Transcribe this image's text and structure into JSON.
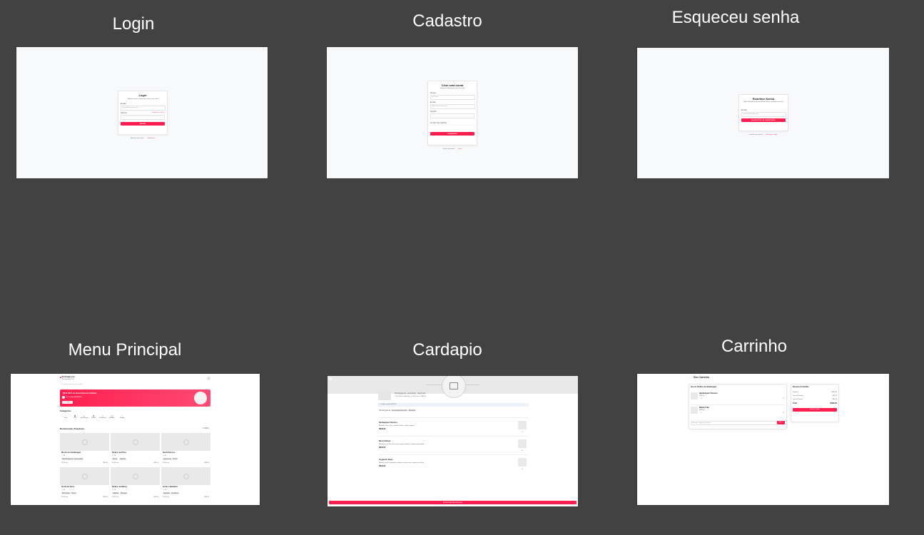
{
  "frames": {
    "login": {
      "title": "Login",
      "heading": "Login",
      "subtitle": "Digite seu email e senha para acessar sua conta",
      "email_label": "Email",
      "email_placeholder": "seuemail@exemplo.com",
      "password_label": "Senha",
      "forgot_link": "Esqueceu a senha?",
      "submit": "Entrar",
      "footer_text": "Não tem uma conta?",
      "footer_link": "Cadastre-se"
    },
    "cadastro": {
      "title": "Cadastro",
      "heading": "Criar uma conta",
      "subtitle": "Digite seus dados para criar sua conta",
      "name_label": "Nome",
      "name_placeholder": "Seu nome",
      "email_label": "Email",
      "email_placeholder": "seuemail@exemplo.com",
      "password_label": "Senha",
      "confirm_label": "Confirmar Senha",
      "submit": "Cadastrar",
      "footer_text": "Já tem uma conta?",
      "footer_link": "Entrar"
    },
    "esqueceu": {
      "title": "Esqueceu senha",
      "heading": "Redefinir Senha",
      "subtitle": "Digite seu email e enviaremos um link para redefinir sua senha",
      "email_label": "Email",
      "email_placeholder": "seuemail@exemplo.com",
      "submit": "Enviar link de redefinição",
      "footer_text": "Lembrou sua senha?",
      "footer_link": "Voltar para o login"
    },
    "menu": {
      "title": "Menu Principal",
      "location_title": "Entregar em",
      "location_value": "Rua Exemplo, 123",
      "search_placeholder": "Buscar restaurantes ou pratos",
      "promo_title": "50% OFF no Seu Primeiro Pedido",
      "promo_subtitle": "Use o código BEMVINDO",
      "promo_button": "Pedir Agora",
      "categories_title": "Categorias",
      "categories": [
        "Pizza",
        "Café",
        "Hambúrguer",
        "Salada",
        "Sobremesa",
        "Bebidas",
        "Frango"
      ],
      "popular_title": "Restaurantes Populares",
      "filter_label": "Filtrar",
      "restaurants": [
        {
          "name": "Mestre do Hambúrguer",
          "rating": "4.8",
          "tags": [
            "Hambúrgueres",
            "Americana"
          ],
          "time": "25-35 min",
          "fee": "R$5,99"
        },
        {
          "name": "Paraíso da Pizza",
          "rating": "4.6",
          "tags": [
            "Pizza",
            "Italiana"
          ],
          "time": "30-40 min",
          "fee": "R$4,99"
        },
        {
          "name": "Sushi Express",
          "rating": "4.7",
          "tags": [
            "Japonesa",
            "Sushi"
          ],
          "time": "35-45 min",
          "fee": "R$6,99"
        },
        {
          "name": "Fiesta de Tacos",
          "rating": "4.5",
          "tags": [
            "Mexicana",
            "Tacos"
          ],
          "time": "20-30 min",
          "fee": "R$3,99"
        },
        {
          "name": "Paraíso da Massa",
          "rating": "4.4",
          "tags": [
            "Italiana",
            "Massas"
          ],
          "time": "25-35 min",
          "fee": "R$5,49"
        },
        {
          "name": "Verde e Saudável",
          "rating": "4.3",
          "tags": [
            "Saladas",
            "Saudável"
          ],
          "time": "15-25 min",
          "fee": "R$4,49"
        }
      ]
    },
    "cardapio": {
      "title": "Cardapio",
      "restaurant_tags": [
        "Hambúrgueres",
        "Americana",
        "Fast Food"
      ],
      "meta": [
        "4.8 (1200+ avaliações)",
        "25-35 min",
        "R$5,99"
      ],
      "notice": "Pedido mínimo: R$15,00",
      "tabs": [
        "Hambúrgueres",
        "Acompanhamentos",
        "Bebidas"
      ],
      "items": [
        {
          "name": "Hambúrguer Clássico",
          "desc": "Blend de carne, alface, tomate, cebola e molho especial",
          "price": "R$29,90"
        },
        {
          "name": "Bacon Deluxe",
          "desc": "Blend de carne, bacon crocante, queijo cheddar e cebola caramelizada",
          "price": "R$34,90"
        },
        {
          "name": "Cogumelo Suíço",
          "desc": "Blend de carne, cogumelos salteados, queijo suíço e maionese de alho",
          "price": "R$32,90"
        }
      ],
      "cart_button": "Ver Carrinho (0 itens)"
    },
    "carrinho": {
      "title": "Carrinho",
      "heading": "Seu Carrinho",
      "section_title": "Seu do Pedido de Hambúrguer",
      "items": [
        {
          "name": "Hambúrguer Clássico",
          "price": "R$29,90",
          "qty": "1"
        },
        {
          "name": "Batata Frita",
          "price": "R$12,90",
          "qty": "1"
        }
      ],
      "notes_placeholder": "Adicionar código promocional",
      "apply_button": "Aplicar",
      "summary_title": "Resumo do Pedido",
      "summary_rows": [
        {
          "label": "Subtotal",
          "value": "R$42,80"
        },
        {
          "label": "Taxa de Entrega",
          "value": "R$5,99"
        },
        {
          "label": "Taxa de Serviço",
          "value": "R$2,14"
        },
        {
          "label": "Total",
          "value": "R$50,93"
        }
      ],
      "checkout_button": "Finalizar Pedido"
    }
  },
  "colors": {
    "canvas": "#424242",
    "accent": "#ff1f4e",
    "frame_bg": "#f8f9fb"
  }
}
